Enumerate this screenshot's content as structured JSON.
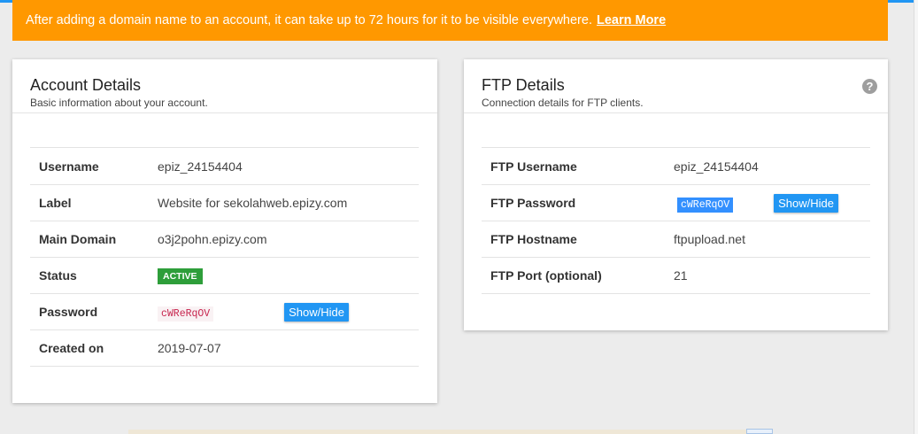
{
  "banner": {
    "text": "After adding a domain name to an account, it can take up to 72 hours for it to be visible everywhere.",
    "link": "Learn More"
  },
  "account": {
    "title": "Account Details",
    "subtitle": "Basic information about your account.",
    "rows": [
      {
        "label": "Username",
        "value": "epiz_24154404"
      },
      {
        "label": "Label",
        "value": "Website for sekolahweb.epizy.com"
      },
      {
        "label": "Main Domain",
        "value": "o3j2pohn.epizy.com"
      },
      {
        "label": "Status",
        "value": "ACTIVE"
      },
      {
        "label": "Password",
        "value": "cWReRqOV",
        "button": "Show/Hide"
      },
      {
        "label": "Created on",
        "value": "2019-07-07"
      }
    ]
  },
  "ftp": {
    "title": "FTP Details",
    "subtitle": "Connection details for FTP clients.",
    "help_icon": "?",
    "rows": [
      {
        "label": "FTP Username",
        "value": "epiz_24154404"
      },
      {
        "label": "FTP Password",
        "value": "cWReRqOV",
        "button": "Show/Hide"
      },
      {
        "label": "FTP Hostname",
        "value": "ftpupload.net"
      },
      {
        "label": "FTP Port (optional)",
        "value": "21"
      }
    ]
  },
  "colors": {
    "banner": "#ff9800",
    "button": "#2196f3",
    "badge": "#2e9e3a",
    "accent_line": "#2196f3"
  }
}
